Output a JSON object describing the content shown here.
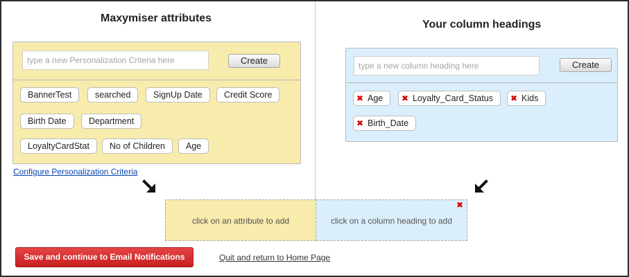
{
  "left": {
    "title": "Maxymiser attributes",
    "input_placeholder": "type a new Personalization Criteria here",
    "create_label": "Create",
    "attributes": [
      "BannerTest",
      "searched",
      "SignUp Date",
      "Credit Score",
      "Birth Date",
      "Department",
      "LoyaltyCardStat",
      "No of Children",
      "Age"
    ],
    "configure_link": "Configure Personalization Criteria"
  },
  "right": {
    "title": "Your column headings",
    "input_placeholder": "type a new column heading here",
    "create_label": "Create",
    "headings": [
      "Age",
      "Loyalty_Card_Status",
      "Kids",
      "Birth_Date"
    ]
  },
  "drop": {
    "attribute_hint": "click on an attribute to add",
    "heading_hint": "click on a column heading to add",
    "close_glyph": "✖"
  },
  "remove_glyph": "✖",
  "actions": {
    "save_label": "Save and continue to Email Notifications",
    "quit_label": "Quit and return to Home Page"
  },
  "colors": {
    "yellow": "#f7ecab",
    "blue": "#dbeefb",
    "save": "#d12a2a",
    "remove": "#d40000"
  }
}
